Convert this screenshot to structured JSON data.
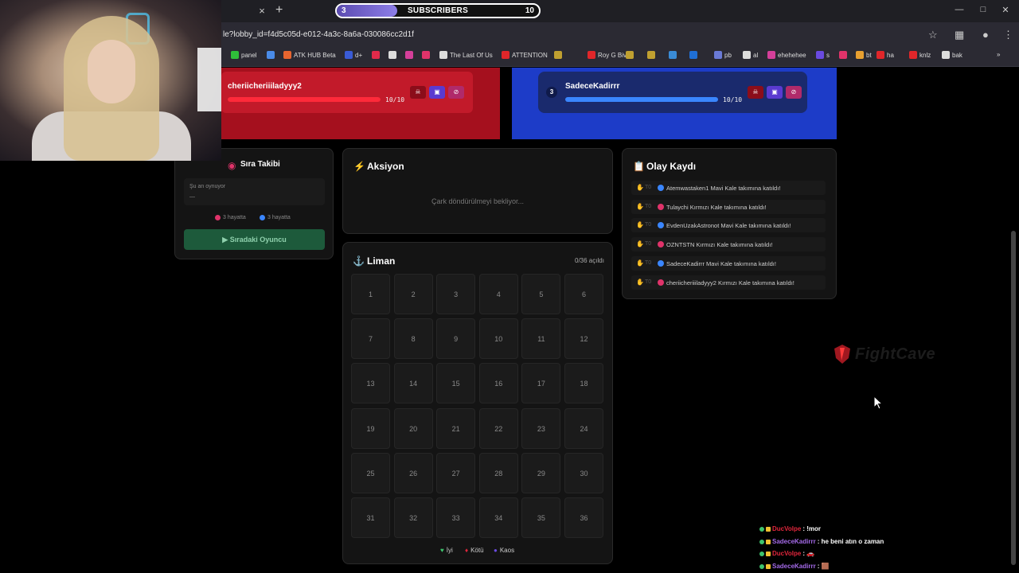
{
  "browser": {
    "url": "le?lobby_id=f4d5c05d-e012-4a3c-8a6a-030086cc2d1f",
    "tab_close": "×",
    "tab_new": "+",
    "bookmarks": [
      {
        "label": "panel",
        "color": "#2fbf3a"
      },
      {
        "label": "",
        "color": "#4a8be8"
      },
      {
        "label": "ATK HUB Beta",
        "color": "#e8652f"
      },
      {
        "label": "d+",
        "color": "#3a5bd6"
      },
      {
        "label": "",
        "color": "#e02a4a"
      },
      {
        "label": "",
        "color": "#dddddd"
      },
      {
        "label": "",
        "color": "#d43f9a"
      },
      {
        "label": "",
        "color": "#e0336a"
      },
      {
        "label": "The Last Of Us",
        "color": "#dddddd"
      },
      {
        "label": "ATTENTION",
        "color": "#e0262a"
      },
      {
        "label": "",
        "color": "#c0a030"
      },
      {
        "label": "Roy G Biv",
        "color": "#e0262a"
      },
      {
        "label": "",
        "color": "#c0a030"
      },
      {
        "label": "",
        "color": "#c0a030"
      },
      {
        "label": "",
        "color": "#3a8bd6"
      },
      {
        "label": "",
        "color": "#1f6fd6"
      },
      {
        "label": "pb",
        "color": "#6a7ad6"
      },
      {
        "label": "al",
        "color": "#dddddd"
      },
      {
        "label": "ehehehee",
        "color": "#d43f9a"
      },
      {
        "label": "s",
        "color": "#6a4ae0"
      },
      {
        "label": "",
        "color": "#e0336a"
      },
      {
        "label": "bt",
        "color": "#e8a030"
      },
      {
        "label": "ha",
        "color": "#e0262a"
      },
      {
        "label": "knlz",
        "color": "#e0262a"
      },
      {
        "label": "bak",
        "color": "#dddddd"
      }
    ]
  },
  "subs": {
    "current": "3",
    "label": "SUBSCRIBERS",
    "goal": "10",
    "progress": 0.3
  },
  "teams": {
    "red": {
      "player": "cheriicheriiiladyyy2",
      "hp": "10/10",
      "hp_fraction": 1.0
    },
    "blue": {
      "player": "SadeceKadirrr",
      "hp": "10/10",
      "hp_fraction": 1.0,
      "badge": "3"
    }
  },
  "sira": {
    "title": "Sıra Takibi",
    "icon": "target-icon",
    "now_playing_label": "Şu an oynuyor",
    "now_playing_value": "—",
    "red_lives": "3 hayatta",
    "blue_lives": "3 hayatta",
    "next_button": "Sıradaki Oyuncu"
  },
  "aksiyon": {
    "title": "Aksiyon",
    "status": "Çark döndürülmeyi bekliyor..."
  },
  "liman": {
    "title": "Liman",
    "opened": "0/36 açıldı",
    "cells": [
      "1",
      "2",
      "3",
      "4",
      "5",
      "6",
      "7",
      "8",
      "9",
      "10",
      "11",
      "12",
      "13",
      "14",
      "15",
      "16",
      "17",
      "18",
      "19",
      "20",
      "21",
      "22",
      "23",
      "24",
      "25",
      "26",
      "27",
      "28",
      "29",
      "30",
      "31",
      "32",
      "33",
      "34",
      "35",
      "36"
    ],
    "legend": [
      {
        "label": "İyi",
        "color": "#3ec46d"
      },
      {
        "label": "Kötü",
        "color": "#e0263c"
      },
      {
        "label": "Kaos",
        "color": "#6a4ae0"
      }
    ]
  },
  "olay": {
    "title": "Olay Kaydı",
    "entries": [
      {
        "time": "T0",
        "team": "blue",
        "text": "Atemwastaken1 Mavi Kale takımına katıldı!"
      },
      {
        "time": "T0",
        "team": "red",
        "text": "Tulaychi Kırmızı Kale takımına katıldı!"
      },
      {
        "time": "T0",
        "team": "blue",
        "text": "EvdenUzakAstronot Mavi Kale takımına katıldı!"
      },
      {
        "time": "T0",
        "team": "red",
        "text": "OZNTSTN Kırmızı Kale takımına katıldı!"
      },
      {
        "time": "T0",
        "team": "blue",
        "text": "SadeceKadirrr Mavi Kale takımına katıldı!"
      },
      {
        "time": "T0",
        "team": "red",
        "text": "cheriicheriiiladyyy2 Kırmızı Kale takımına katıldı!"
      }
    ]
  },
  "watermark": {
    "text": "FightCave"
  },
  "chat": [
    {
      "user": "DucVolpe",
      "user_color": "#e0263c",
      "msg": ": !mor"
    },
    {
      "user": "SadeceKadirrr",
      "user_color": "#a46ae8",
      "msg": ": he beni atın o zaman"
    },
    {
      "user": "DucVolpe",
      "user_color": "#e0263c",
      "msg": ": 🚗"
    },
    {
      "user": "SadeceKadirrr",
      "user_color": "#a46ae8",
      "msg": ": 🟫"
    }
  ],
  "colors": {
    "red_team": "#c21a2a",
    "blue_team": "#1d3cc8",
    "next_button": "#1d5a3b"
  }
}
